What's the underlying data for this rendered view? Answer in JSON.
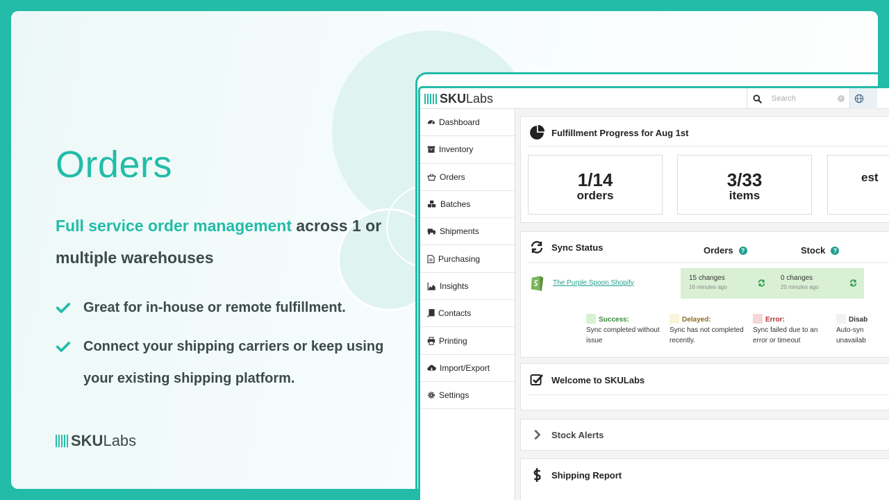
{
  "hero": {
    "title": "Orders",
    "subtitle_accent": "Full service order management",
    "subtitle_rest": " across 1 or multiple warehouses",
    "bullets": [
      "Great for in-house or remote fulfillment.",
      "Connect your shipping carriers or keep using your existing shipping platform."
    ],
    "brand_bold": "SKU",
    "brand_light": "Labs"
  },
  "app": {
    "logo_bold": "SKU",
    "logo_light": "Labs",
    "search_placeholder": "Search",
    "sidebar": [
      {
        "label": "Dashboard",
        "icon": "dashboard-icon"
      },
      {
        "label": "Inventory",
        "icon": "archive-icon"
      },
      {
        "label": "Orders",
        "icon": "basket-icon"
      },
      {
        "label": "Batches",
        "icon": "cubes-icon"
      },
      {
        "label": "Shipments",
        "icon": "truck-icon"
      },
      {
        "label": "Purchasing",
        "icon": "document-icon"
      },
      {
        "label": "Insights",
        "icon": "area-chart-icon"
      },
      {
        "label": "Contacts",
        "icon": "book-icon"
      },
      {
        "label": "Printing",
        "icon": "printer-icon"
      },
      {
        "label": "Import/Export",
        "icon": "cloud-icon"
      },
      {
        "label": "Settings",
        "icon": "gear-icon"
      }
    ],
    "progress": {
      "title": "Fulfillment Progress for Aug 1st",
      "stats": [
        {
          "value": "1/14",
          "label": "orders"
        },
        {
          "value": "3/33",
          "label": "items"
        },
        {
          "value": "",
          "label": "est"
        }
      ]
    },
    "sync": {
      "title": "Sync Status",
      "col_orders": "Orders",
      "col_stock": "Stock",
      "store": "The Purple Spoon Shopify",
      "orders_changes": "15 changes",
      "orders_ago": "16 minutes ago",
      "stock_changes": "0 changes",
      "stock_ago": "20 minutes ago",
      "legend": [
        {
          "head": "Success:",
          "text": "Sync completed without issue",
          "color": "#d9f0d4",
          "head_color": "#3a8a3a"
        },
        {
          "head": "Delayed:",
          "text": "Sync has not completed recently.",
          "color": "#fbf3d8",
          "head_color": "#8a6d20"
        },
        {
          "head": "Error:",
          "text": "Sync failed due to an error or timeout",
          "color": "#f6d6d6",
          "head_color": "#b03030"
        },
        {
          "head": "Disab",
          "text": "Auto-syn unavailab",
          "color": "#f2f2f2",
          "head_color": "#333333"
        }
      ]
    },
    "welcome_title": "Welcome to SKULabs",
    "alerts_title": "Stock Alerts",
    "shipping_title": "Shipping Report"
  },
  "colors": {
    "accent": "#22bca8",
    "text": "#3b4a4a"
  }
}
